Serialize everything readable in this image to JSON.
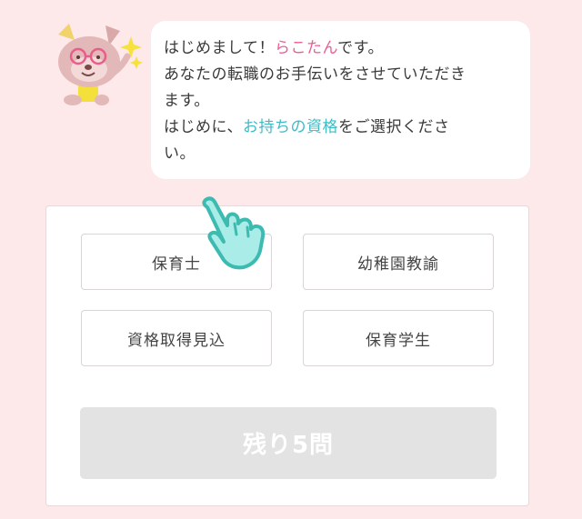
{
  "bubble": {
    "line1_a": "はじめまして！",
    "line1_name": "らこたん",
    "line1_b": "です。",
    "line2": "あなたの転職のお手伝いをさせていただき",
    "line3": "ます。",
    "line4_a": "はじめに、",
    "line4_highlight": "お持ちの資格",
    "line4_b": "をご選択くださ",
    "line5": "い。"
  },
  "options": [
    {
      "label": "保育士"
    },
    {
      "label": "幼稚園教諭"
    },
    {
      "label": "資格取得見込"
    },
    {
      "label": "保育学生"
    }
  ],
  "progress": {
    "label": "残り5問"
  },
  "colors": {
    "background": "#fde8ea",
    "name_highlight": "#ef5b93",
    "keyword_highlight": "#3dbbc6",
    "hand": "#a9ece8"
  },
  "icons": {
    "mascot": "raccoon-mascot-icon",
    "sparkle": "sparkle-icon",
    "hand": "pointing-hand-icon"
  }
}
